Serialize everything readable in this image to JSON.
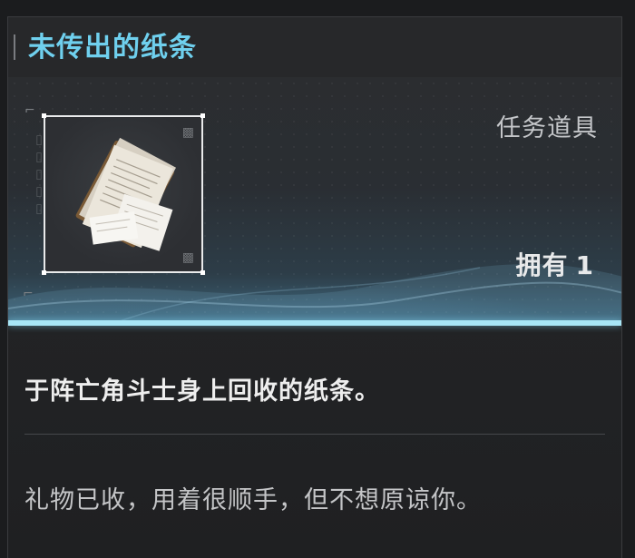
{
  "item": {
    "name": "未传出的纸条",
    "category": "任务道具",
    "owned_label": "拥有",
    "owned_count": "1",
    "description": "于阵亡角斗士身上回收的纸条。",
    "flavor_text": "礼物已收，用着很顺手，但不想原谅你。",
    "icon": "paper-documents-icon"
  },
  "colors": {
    "title": "#6fd0ee",
    "accent_line": "#a8e6f6",
    "background": "#1b1c1e"
  }
}
